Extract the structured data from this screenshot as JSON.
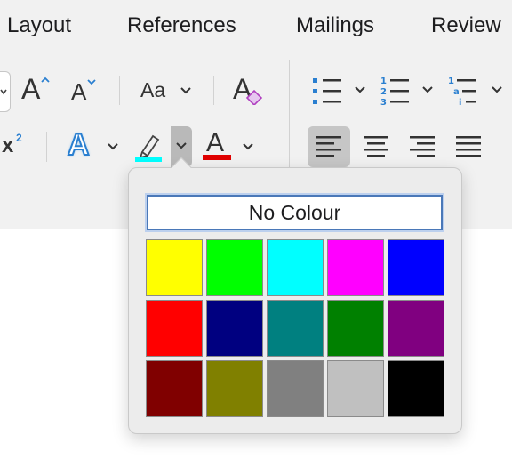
{
  "tabs": [
    "Layout",
    "References",
    "Mailings",
    "Review"
  ],
  "font_tools": {
    "grow_font_glyph": "A",
    "shrink_font_glyph": "A",
    "change_case_label": "Aa",
    "superscript_glyph": "x",
    "superscript_exp": "2",
    "text_effects_glyph": "A",
    "font_color_glyph": "A",
    "clear_format_glyph": "A"
  },
  "colors": {
    "accent": "#4a78b8",
    "list_icon": "#2a7fd0",
    "highlight_current": "#00ffff",
    "font_color_current": "#e00000"
  },
  "popup": {
    "no_colour_label": "No Colour",
    "swatches": [
      {
        "name": "Yellow",
        "color": "#ffff00"
      },
      {
        "name": "Bright Green",
        "color": "#00ff00"
      },
      {
        "name": "Turquoise",
        "color": "#00ffff"
      },
      {
        "name": "Pink",
        "color": "#ff00ff"
      },
      {
        "name": "Blue",
        "color": "#0000ff"
      },
      {
        "name": "Red",
        "color": "#ff0000"
      },
      {
        "name": "Dark Blue",
        "color": "#000080"
      },
      {
        "name": "Teal",
        "color": "#008080"
      },
      {
        "name": "Green",
        "color": "#008000"
      },
      {
        "name": "Violet",
        "color": "#800080"
      },
      {
        "name": "Dark Red",
        "color": "#800000"
      },
      {
        "name": "Dark Yellow",
        "color": "#808000"
      },
      {
        "name": "Grey 50%",
        "color": "#808080"
      },
      {
        "name": "Grey 25%",
        "color": "#c0c0c0"
      },
      {
        "name": "Black",
        "color": "#000000"
      }
    ]
  }
}
